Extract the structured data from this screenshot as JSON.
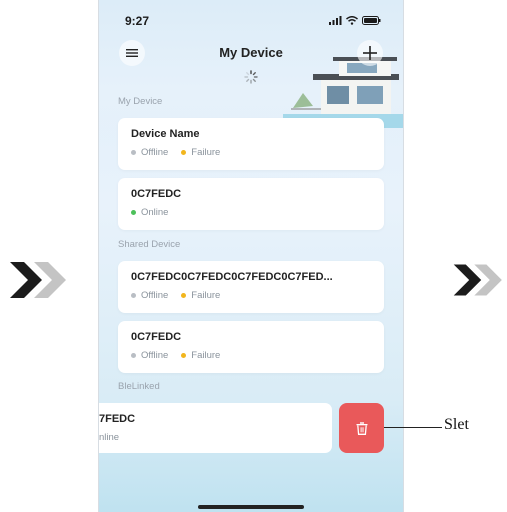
{
  "status_bar": {
    "time": "9:27"
  },
  "header": {
    "title": "My Device"
  },
  "sections": {
    "my_device": "My Device",
    "shared_device": "Shared Device",
    "ble_linked": "BleLinked"
  },
  "my_devices": [
    {
      "name": "Device Name",
      "statuses": [
        "Offline",
        "Failure"
      ]
    },
    {
      "name": "0C7FEDC",
      "statuses": [
        "Online"
      ]
    }
  ],
  "shared_devices": [
    {
      "name": "0C7FEDC0C7FEDC0C7FEDC0C7FED...",
      "statuses": [
        "Offline",
        "Failure"
      ]
    },
    {
      "name": "0C7FEDC",
      "statuses": [
        "Offline",
        "Failure"
      ]
    }
  ],
  "ble_linked": {
    "name_partial": "7FEDC",
    "status_partial": "nline"
  },
  "annotation": {
    "label": "Slet"
  },
  "colors": {
    "offline_dot": "#b9bec4",
    "failure_dot": "#f2b61d",
    "online_dot": "#4cc05a",
    "delete": "#e9595a",
    "chevron_dark": "#1c1c1c",
    "chevron_light": "#c4c4c4"
  },
  "icons": [
    "menu-icon",
    "plus-icon",
    "loading-icon",
    "trash-icon",
    "signal-icon",
    "wifi-icon",
    "battery-icon",
    "chevron-right-icon"
  ]
}
